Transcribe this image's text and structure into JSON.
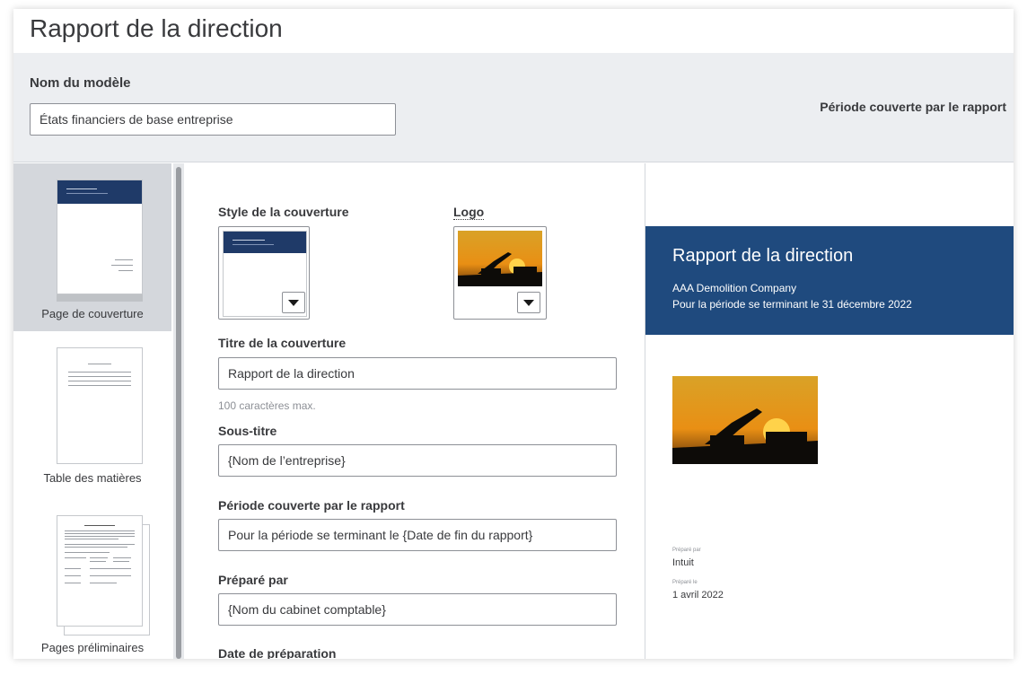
{
  "page": {
    "title": "Rapport de la direction"
  },
  "header": {
    "model_label": "Nom du modèle",
    "model_value": "États financiers de base entreprise",
    "period_label": "Période couverte par le rapport"
  },
  "sidebar": {
    "items": [
      {
        "label": "Page de couverture",
        "active": true
      },
      {
        "label": "Table des matières",
        "active": false
      },
      {
        "label": "Pages préliminaires",
        "active": false
      }
    ]
  },
  "form": {
    "cover_style_label": "Style de la couverture",
    "logo_label": "Logo",
    "cover_title_label": "Titre de la couverture",
    "cover_title_value": "Rapport de la direction",
    "cover_title_hint": "100 caractères max.",
    "subtitle_label": "Sous-titre",
    "subtitle_value": "{Nom de l’entreprise}",
    "period_label": "Période couverte par le rapport",
    "period_value": "Pour la période se terminant le {Date de fin du rapport}",
    "prepared_by_label": "Préparé par",
    "prepared_by_value": "{Nom du cabinet comptable}",
    "prep_date_label": "Date de préparation"
  },
  "preview": {
    "title": "Rapport de la direction",
    "company": "AAA Demolition Company",
    "period": "Pour la période se terminant le 31 décembre 2022",
    "prepared_by_caption": "Préparé par",
    "prepared_by": "Intuit",
    "prepared_on_caption": "Préparé le",
    "prepared_on": "1 avril 2022"
  },
  "colors": {
    "cover_band": "#1f4a7e",
    "mini_header": "#1f3a68",
    "header_bg": "#eceef1",
    "active_item": "#d4d7dc"
  }
}
